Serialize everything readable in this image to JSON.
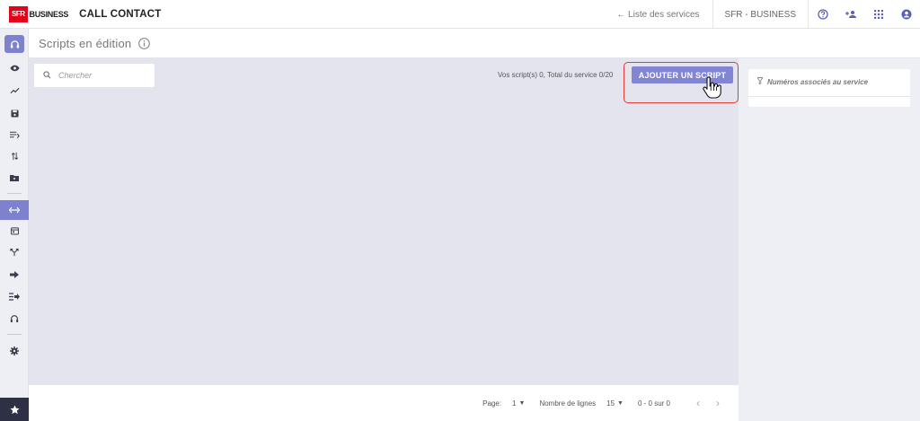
{
  "header": {
    "logo_sfr": "SFR",
    "logo_business": "BUSINESS",
    "app_title": "CALL CONTACT",
    "back_link": "← Liste des services",
    "account": "SFR - BUSINESS",
    "icons": [
      "help-icon",
      "users-icon",
      "apps-grid-icon",
      "account-icon"
    ]
  },
  "sidebar": {
    "items": [
      "headset-icon",
      "eye-icon",
      "trend-icon",
      "save-icon",
      "queue-icon",
      "transfer-icon",
      "folder-icon",
      "scripts-icon",
      "calendar-icon",
      "routing-icon",
      "forward-icon",
      "queue-forward-icon",
      "headphones-icon",
      "settings-icon",
      "star-icon"
    ],
    "active": "scripts-icon",
    "accent_color": "#7e81cd"
  },
  "page": {
    "title": "Scripts en édition"
  },
  "toolbar": {
    "search_placeholder": "Chercher",
    "script_count": "Vos script(s) 0, Total du service 0/20",
    "add_button": "AJOUTER UN SCRIPT"
  },
  "pagination": {
    "page_label": "Page:",
    "page_value": "1",
    "rows_label": "Nombre de lignes",
    "rows_value": "15",
    "range": "0 - 0 sur 0"
  },
  "right_panel": {
    "numbers_title": "Numéros associés au service"
  }
}
